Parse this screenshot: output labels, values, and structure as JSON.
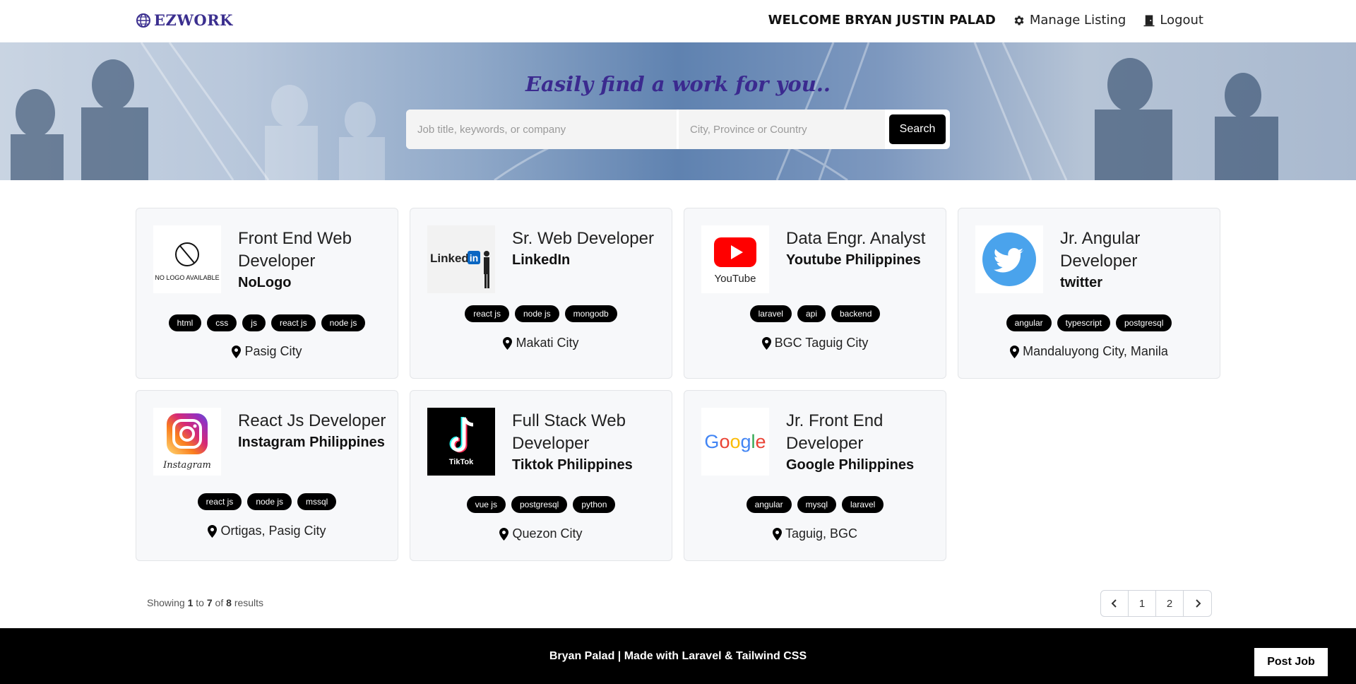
{
  "nav": {
    "logo_text": "EZWORK",
    "welcome": "WELCOME BRYAN JUSTIN PALAD",
    "manage_label": "Manage Listing",
    "logout_label": "Logout"
  },
  "hero": {
    "title": "Easily find a work for you..",
    "keyword_placeholder": "Job title, keywords, or company",
    "location_placeholder": "City, Province or Country",
    "search_label": "Search"
  },
  "jobs": [
    {
      "title": "Front End Web Developer",
      "company": "NoLogo",
      "logo": "no-logo-icon",
      "logo_caption": "NO LOGO AVAILABLE",
      "tags": [
        "html",
        "css",
        "js",
        "react js",
        "node js"
      ],
      "location": "Pasig City"
    },
    {
      "title": "Sr. Web Developer",
      "company": "LinkedIn",
      "logo": "linkedin-icon",
      "logo_caption": "Linked in",
      "tags": [
        "react js",
        "node js",
        "mongodb"
      ],
      "location": "Makati City"
    },
    {
      "title": "Data Engr. Analyst",
      "company": "Youtube Philippines",
      "logo": "youtube-icon",
      "logo_caption": "YouTube",
      "tags": [
        "laravel",
        "api",
        "backend"
      ],
      "location": "BGC Taguig City"
    },
    {
      "title": "Jr. Angular Developer",
      "company": "twitter",
      "logo": "twitter-icon",
      "logo_caption": "",
      "tags": [
        "angular",
        "typescript",
        "postgresql"
      ],
      "location": "Mandaluyong City, Manila"
    },
    {
      "title": "React Js Developer",
      "company": "Instagram Philippines",
      "logo": "instagram-icon",
      "logo_caption": "Instagram",
      "tags": [
        "react js",
        "node js",
        "mssql"
      ],
      "location": "Ortigas, Pasig City"
    },
    {
      "title": "Full Stack Web Developer",
      "company": "Tiktok Philippines",
      "logo": "tiktok-icon",
      "logo_caption": "TikTok",
      "tags": [
        "vue js",
        "postgresql",
        "python"
      ],
      "location": "Quezon City"
    },
    {
      "title": "Jr. Front End Developer",
      "company": "Google Philippines",
      "logo": "google-icon",
      "logo_caption": "Google",
      "tags": [
        "angular",
        "mysql",
        "laravel"
      ],
      "location": "Taguig, BGC"
    }
  ],
  "pagination": {
    "showing_prefix": "Showing",
    "from": "1",
    "to_word": "to",
    "to": "7",
    "of_word": "of",
    "total": "8",
    "results_word": "results",
    "pages": [
      "1",
      "2"
    ],
    "prev_icon": "chevron-left-icon",
    "next_icon": "chevron-right-icon"
  },
  "footer": {
    "text": "Bryan Palad | Made with Laravel & Tailwind CSS",
    "post_job_label": "Post Job"
  }
}
